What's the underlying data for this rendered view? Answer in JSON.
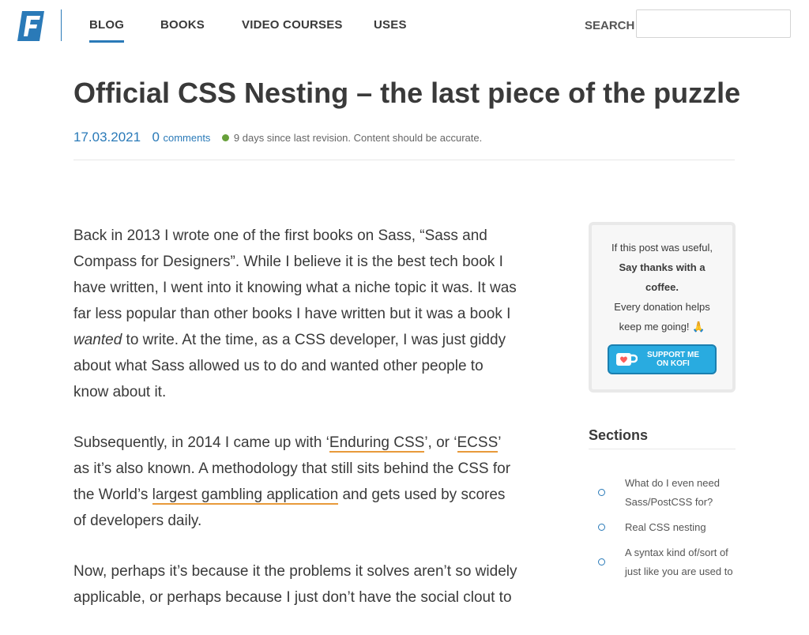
{
  "nav": {
    "logo": "benfrain-logo-icon",
    "items": [
      {
        "label": "BLOG",
        "active": true
      },
      {
        "label": "BOOKS"
      },
      {
        "label": "VIDEO COURSES"
      },
      {
        "label": "USES"
      }
    ],
    "search_label": "SEARCH",
    "search_value": ""
  },
  "article": {
    "title": "Official CSS Nesting – the last piece of the puzzle",
    "date": "17.03.2021",
    "comment_count": "0",
    "comments_label": "comments",
    "revision_status": "9 days since last revision. Content should be accurate.",
    "status_color": "#67a03a",
    "p1": {
      "a": "Back in 2013 I wrote one of the first books on Sass, “Sass and Compass for Designers”. While I believe it is the best tech book I have written, I went into it knowing what a niche topic it was. It was far less popular than other books I have written but it was a book I ",
      "em": "wanted",
      "b": " to write. At the time, as a CSS developer, I was just giddy about what Sass allowed us to do and wanted other people to know about it."
    },
    "p2": {
      "a": "Subsequently, in 2014 I came up with ‘",
      "link1": "Enduring CSS",
      "b": "’, or ‘",
      "link2": "ECSS",
      "c": "’ as it’s also known. A methodology that still sits behind the CSS for the World’s ",
      "link3": "largest gambling application",
      "d": " and gets used by scores of developers daily."
    },
    "p3": {
      "a": "Now, perhaps it’s because it the problems it solves aren’t so widely applicable, or perhaps because I just don’t have the social clout to"
    }
  },
  "sidebar": {
    "kofi": {
      "line1": "If this post was useful,",
      "line2": "Say thanks with a coffee.",
      "line3": "Every donation helps keep me going! 🙏",
      "button_label_1": "SUPPORT ME",
      "button_label_2": "ON KOFI",
      "button_icon": "kofi-cup-icon",
      "accent": "#29abe0"
    },
    "sections_title": "Sections",
    "sections": [
      {
        "label": "What do I even need Sass/PostCSS for?"
      },
      {
        "label": "Real CSS nesting"
      },
      {
        "label": "A syntax kind of/sort of just like you are used to"
      }
    ]
  },
  "colors": {
    "accent": "#2a7ab8",
    "link_underline": "#e89a3a",
    "text": "#3a3a3a"
  }
}
